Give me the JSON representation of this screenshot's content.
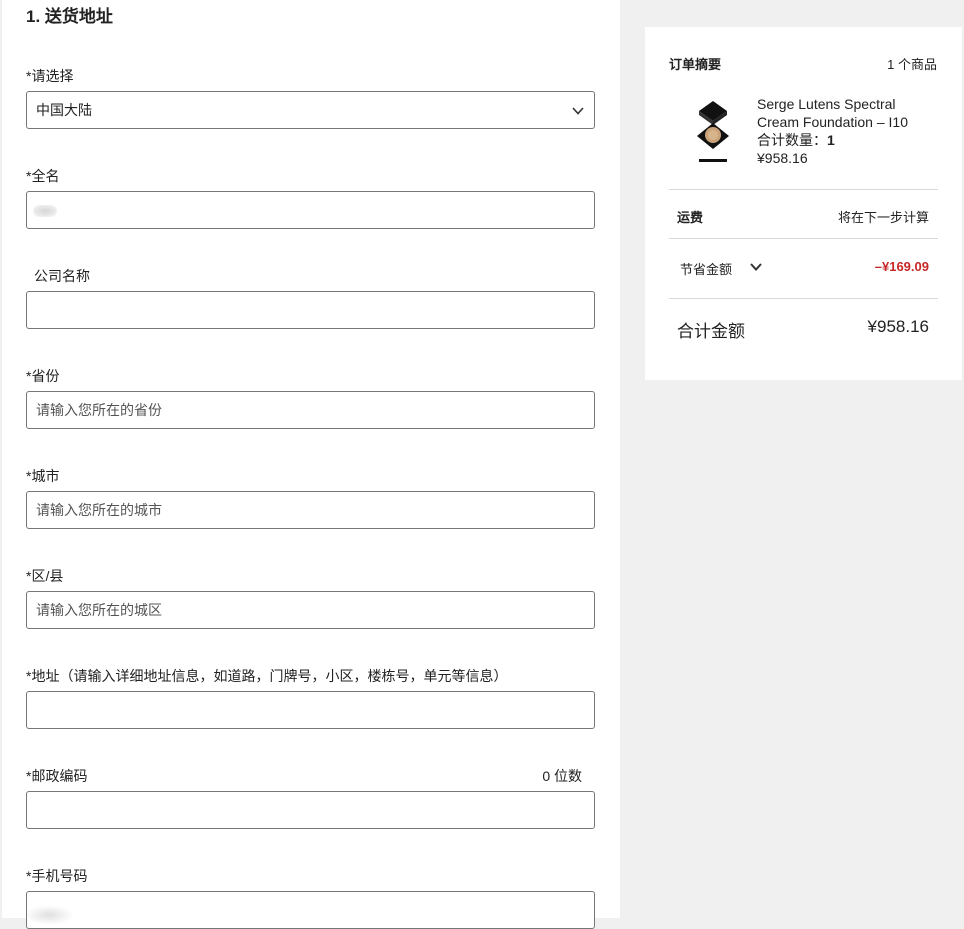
{
  "form": {
    "section_title": "1. 送货地址",
    "country": {
      "label": "*请选择",
      "value": "中国大陆"
    },
    "fullname": {
      "label": "*全名",
      "value": ""
    },
    "company": {
      "label": "公司名称",
      "value": ""
    },
    "province": {
      "label": "*省份",
      "placeholder": "请输入您所在的省份"
    },
    "city": {
      "label": "*城市",
      "placeholder": "请输入您所在的城市"
    },
    "district": {
      "label": "*区/县",
      "placeholder": "请输入您所在的城区"
    },
    "address": {
      "label": "*地址（请输入详细地址信息，如道路，门牌号，小区，楼栋号，单元等信息）",
      "value": ""
    },
    "postcode": {
      "label": "*邮政编码",
      "counter": "0 位数",
      "value": ""
    },
    "phone": {
      "label": "*手机号码",
      "value": ""
    }
  },
  "summary": {
    "title": "订单摘要",
    "item_count": "1 个商品",
    "product": {
      "name": "Serge Lutens Spectral Cream Foundation – I10",
      "qty_label": "合计数量：",
      "qty_value": "1",
      "price": "¥958.16"
    },
    "shipping": {
      "label": "运费",
      "value": "将在下一步计算"
    },
    "savings": {
      "label": "节省金额",
      "value": "–¥169.09"
    },
    "total": {
      "label": "合计金额",
      "value": "¥958.16"
    }
  },
  "colors": {
    "savings_red": "#c62828",
    "page_bg": "#f0f0f0",
    "input_border": "#777777"
  }
}
